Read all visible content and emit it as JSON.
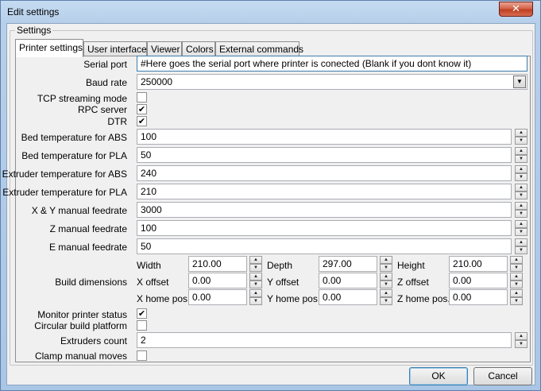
{
  "window": {
    "title": "Edit settings",
    "close_glyph": "✕"
  },
  "group": {
    "title": "Settings"
  },
  "tabs": [
    {
      "label": "Printer settings",
      "active": true
    },
    {
      "label": "User interface"
    },
    {
      "label": "Viewer"
    },
    {
      "label": "Colors"
    },
    {
      "label": "External commands"
    }
  ],
  "fields": {
    "serial_port": {
      "label": "Serial port",
      "value": "#Here goes the serial port where printer is conected (Blank if you dont know it)"
    },
    "baud_rate": {
      "label": "Baud rate",
      "value": "250000"
    },
    "tcp_streaming": {
      "label": "TCP streaming mode",
      "checked": false
    },
    "rpc_server": {
      "label": "RPC server",
      "checked": true
    },
    "dtr": {
      "label": "DTR",
      "checked": true
    },
    "bed_abs": {
      "label": "Bed temperature for ABS",
      "value": "100"
    },
    "bed_pla": {
      "label": "Bed temperature for PLA",
      "value": "50"
    },
    "ext_abs": {
      "label": "Extruder temperature for ABS",
      "value": "240"
    },
    "ext_pla": {
      "label": "Extruder temperature for PLA",
      "value": "210"
    },
    "xy_feed": {
      "label": "X & Y manual feedrate",
      "value": "3000"
    },
    "z_feed": {
      "label": "Z manual feedrate",
      "value": "100"
    },
    "e_feed": {
      "label": "E manual feedrate",
      "value": "50"
    }
  },
  "build": {
    "label": "Build dimensions",
    "width": {
      "label": "Width",
      "value": "210.00"
    },
    "depth": {
      "label": "Depth",
      "value": "297.00"
    },
    "height": {
      "label": "Height",
      "value": "210.00"
    },
    "x_offset": {
      "label": "X offset",
      "value": "0.00"
    },
    "y_offset": {
      "label": "Y offset",
      "value": "0.00"
    },
    "z_offset": {
      "label": "Z offset",
      "value": "0.00"
    },
    "x_home": {
      "label": "X home pos.",
      "value": "0.00"
    },
    "y_home": {
      "label": "Y home pos.",
      "value": "0.00"
    },
    "z_home": {
      "label": "Z home pos.",
      "value": "0.00"
    }
  },
  "extra": {
    "monitor_status": {
      "label": "Monitor printer status",
      "checked": true
    },
    "circular_platform": {
      "label": "Circular build platform",
      "checked": false
    },
    "extruders_count": {
      "label": "Extruders count",
      "value": "2"
    },
    "clamp_moves": {
      "label": "Clamp manual moves",
      "checked": false
    }
  },
  "buttons": {
    "ok": "OK",
    "cancel": "Cancel"
  },
  "glyphs": {
    "check": "✔",
    "spin_up": "▲",
    "spin_down": "▼",
    "dropdown": "▼"
  }
}
